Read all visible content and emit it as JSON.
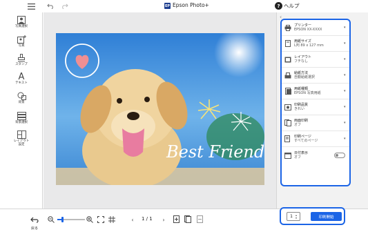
{
  "app": {
    "title": "Epson Photo+",
    "logo_text": "EP",
    "help_label": "ヘルプ"
  },
  "tools": [
    {
      "label": "写真選択",
      "icon": "photo-select-icon"
    },
    {
      "label": "写真",
      "icon": "add-photo-icon"
    },
    {
      "label": "スタンプ",
      "icon": "stamp-icon"
    },
    {
      "label": "テキスト",
      "icon": "text-icon",
      "glyph": "A"
    },
    {
      "label": "背景",
      "icon": "background-icon"
    },
    {
      "label": "背景選択",
      "icon": "background-select-icon"
    },
    {
      "label": "レイアウト設定",
      "icon": "layout-settings-icon"
    }
  ],
  "photo": {
    "caption": "Best Friend"
  },
  "settings": [
    {
      "label": "プリンター",
      "value": "EPSON XX-XXXX",
      "icon": "printer-icon"
    },
    {
      "label": "用紙サイズ",
      "value": "L判 89 x 127 mm",
      "icon": "paper-size-icon"
    },
    {
      "label": "レイアウト",
      "value": "フチなし",
      "icon": "layout-icon"
    },
    {
      "label": "給紙方法",
      "value": "自動給紙選択",
      "icon": "paper-feed-icon"
    },
    {
      "label": "用紙種類",
      "value": "EPSON 写真用紙",
      "icon": "paper-type-icon"
    },
    {
      "label": "印刷品質",
      "value": "きれい",
      "icon": "print-quality-icon"
    },
    {
      "label": "両面印刷",
      "value": "オフ",
      "icon": "duplex-icon"
    },
    {
      "label": "印刷ページ",
      "value": "すべてのページ",
      "icon": "print-pages-icon"
    },
    {
      "label": "日付表示",
      "value": "オフ",
      "icon": "date-icon"
    }
  ],
  "bottom": {
    "back_label": "戻る",
    "page_indicator": "1 / 1",
    "copies": "1",
    "print_label": "印刷開始"
  },
  "colors": {
    "accent": "#1b64e6"
  }
}
